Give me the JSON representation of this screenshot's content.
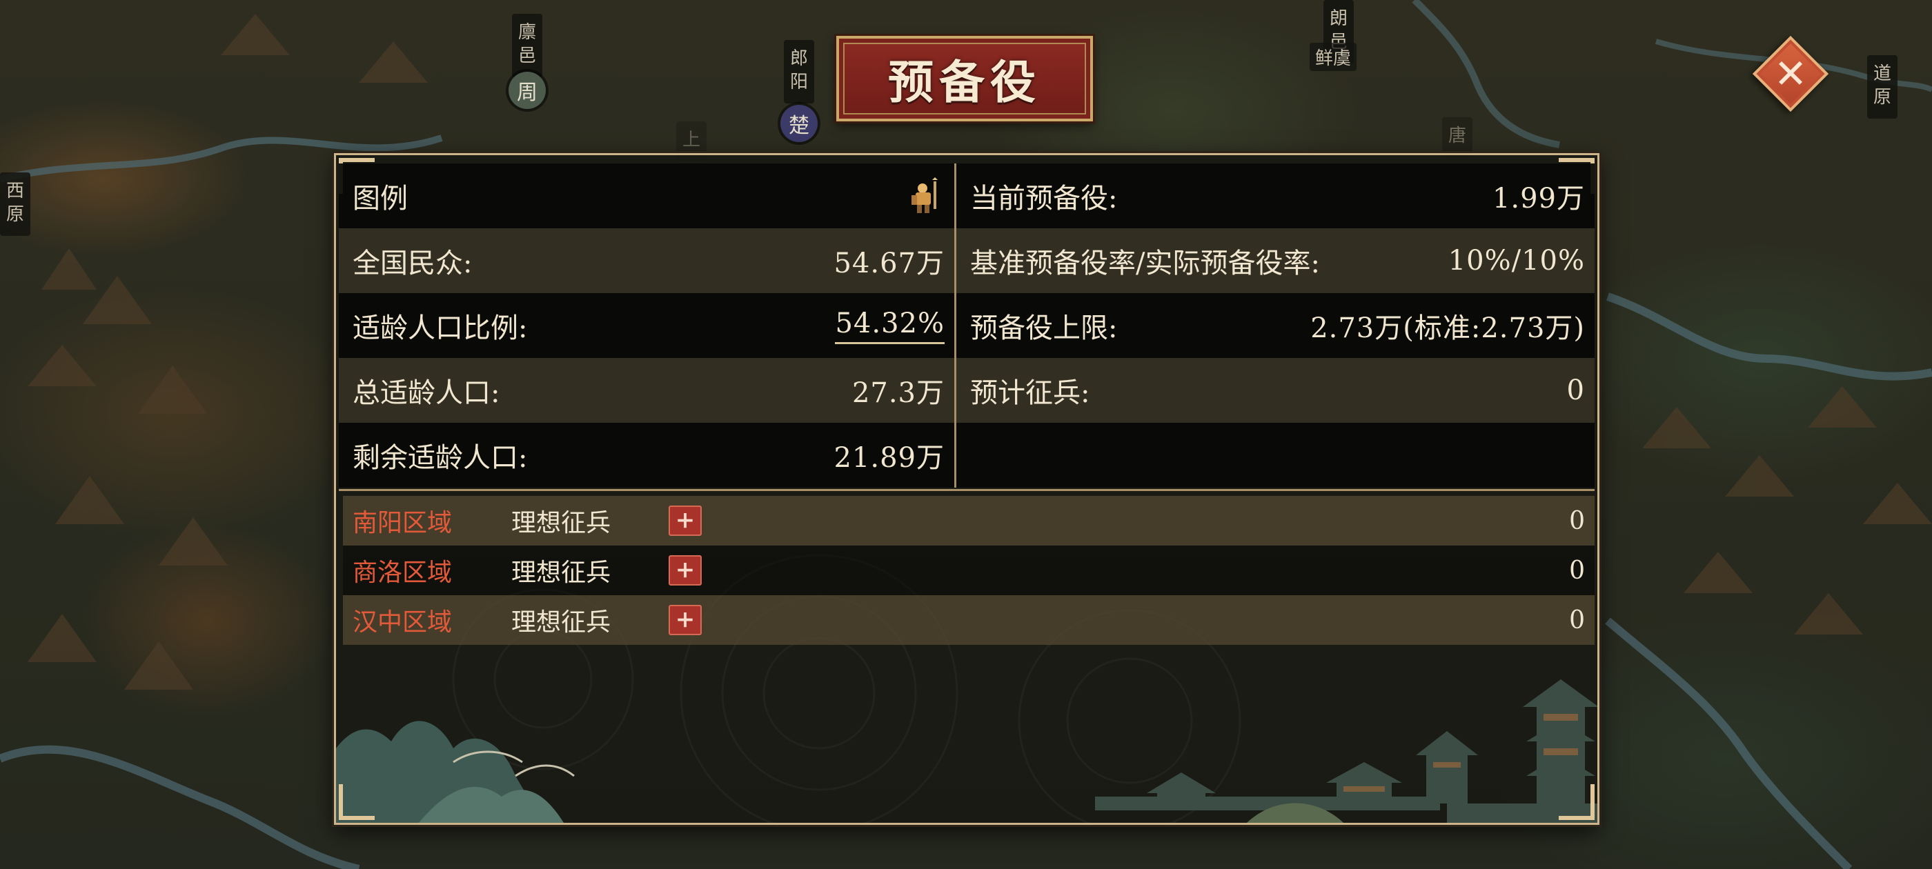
{
  "title": "预备役",
  "map_markers": [
    {
      "id": "linyi",
      "text": "廪邑",
      "seal": "周"
    },
    {
      "id": "langyang",
      "text": "郎阳",
      "seal": "楚"
    },
    {
      "id": "xiyuan",
      "text": "西原"
    },
    {
      "id": "daoyuan",
      "text": "道原"
    },
    {
      "id": "langyi",
      "text": "朗邑"
    },
    {
      "id": "xianyu",
      "text": "鲜虞"
    },
    {
      "id": "shang",
      "text": "上"
    },
    {
      "id": "tang",
      "text": "唐"
    }
  ],
  "left_stats": [
    {
      "label": "图例",
      "value": "",
      "icon": "soldier-icon"
    },
    {
      "label": "全国民众:",
      "value": "54.67万"
    },
    {
      "label": "适龄人口比例:",
      "value": "54.32%"
    },
    {
      "label": "总适龄人口:",
      "value": "27.3万"
    },
    {
      "label": "剩余适龄人口:",
      "value": "21.89万"
    }
  ],
  "right_stats": [
    {
      "label": "当前预备役:",
      "value": "1.99万"
    },
    {
      "label": "基准预备役率/实际预备役率:",
      "value": "10%/10%"
    },
    {
      "label": "预备役上限:",
      "value": "2.73万(标准:2.73万)"
    },
    {
      "label": "预计征兵:",
      "value": "0"
    }
  ],
  "regions": [
    {
      "name": "南阳区域",
      "label": "理想征兵",
      "button": "+",
      "value": "0"
    },
    {
      "name": "商洛区域",
      "label": "理想征兵",
      "button": "+",
      "value": "0"
    },
    {
      "name": "汉中区域",
      "label": "理想征兵",
      "button": "+",
      "value": "0"
    }
  ],
  "close_button": "✕",
  "colors": {
    "title_bg": "#8c2a22",
    "region_name": "#e25a3a",
    "panel_border": "#cdb48a",
    "close_bg": "#c9553a"
  }
}
